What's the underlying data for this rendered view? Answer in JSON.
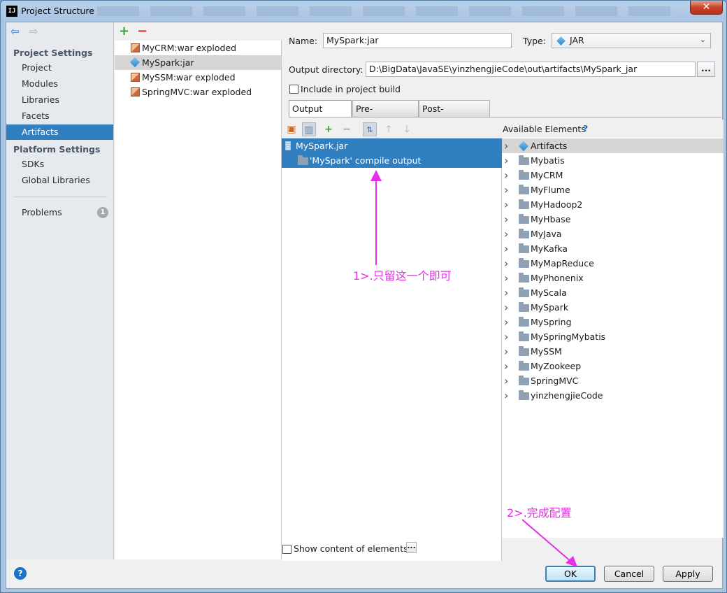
{
  "window": {
    "title": "Project Structure",
    "close_glyph": "✕",
    "app_icon_text": "IJ"
  },
  "nav": {
    "back_icon": "arrow-left-icon",
    "forward_icon": "arrow-right-icon",
    "project_settings_header": "Project Settings",
    "project_settings": [
      "Project",
      "Modules",
      "Libraries",
      "Facets",
      "Artifacts"
    ],
    "selected": "Artifacts",
    "platform_settings_header": "Platform Settings",
    "platform_settings": [
      "SDKs",
      "Global Libraries"
    ],
    "problems_label": "Problems",
    "problems_count": "1"
  },
  "artifacts": {
    "add_glyph": "+",
    "remove_glyph": "−",
    "items": [
      "MyCRM:war exploded",
      "MySpark:jar",
      "MySSM:war exploded",
      "SpringMVC:war exploded"
    ],
    "selected": "MySpark:jar"
  },
  "config": {
    "name_label": "Name:",
    "name_value": "MySpark:jar",
    "type_label": "Type:",
    "type_value": "JAR",
    "output_dir_label": "Output directory:",
    "output_dir_value": "D:\\BigData\\JavaSE\\yinzhengjieCode\\out\\artifacts\\MySpark_jar",
    "browse_label": "...",
    "include_build_label": "Include in project build",
    "include_build_checked": false,
    "tabs": [
      "Output Layout",
      "Pre-processing",
      "Post-processing"
    ],
    "selected_tab": "Output Layout"
  },
  "output_layout": {
    "root": "MySpark.jar",
    "child": "'MySpark' compile output",
    "show_content_label": "Show content of elements",
    "show_content_button": "..."
  },
  "available": {
    "header": "Available Elements",
    "help_glyph": "?",
    "items": [
      "Artifacts",
      "Mybatis",
      "MyCRM",
      "MyFlume",
      "MyHadoop2",
      "MyHbase",
      "MyJava",
      "MyKafka",
      "MyMapReduce",
      "MyPhonenix",
      "MyScala",
      "MySpark",
      "MySpring",
      "MySpringMybatis",
      "MySSM",
      "MyZookeep",
      "SpringMVC",
      "yinzhengjieCode"
    ]
  },
  "buttons": {
    "ok": "OK",
    "cancel": "Cancel",
    "apply": "Apply",
    "help": "?"
  },
  "annotations": {
    "note1": "1>.只留这一个即可",
    "note2": "2>.完成配置",
    "color": "#e62ee6"
  }
}
